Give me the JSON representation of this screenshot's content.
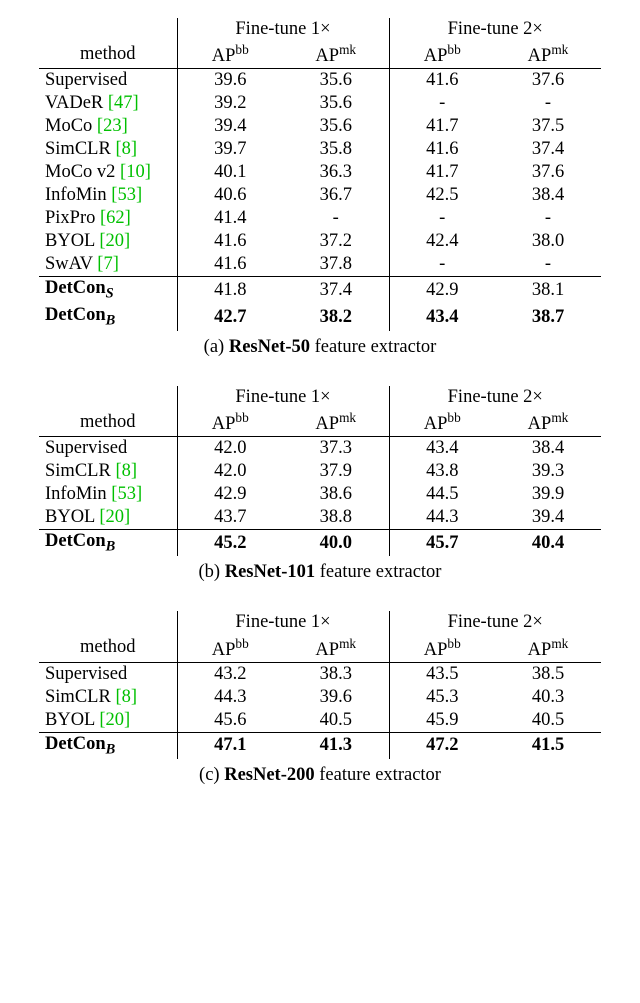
{
  "headers": {
    "method": "method",
    "ft1": "Fine-tune 1",
    "ft2": "Fine-tune 2",
    "times": "×",
    "ap": "AP",
    "bb": "bb",
    "mk": "mk"
  },
  "tables": [
    {
      "rows": [
        {
          "name": "Supervised",
          "cite": "",
          "bold": false,
          "ft1bb": "39.6",
          "ft1mk": "35.6",
          "ft2bb": "41.6",
          "ft2mk": "37.6"
        },
        {
          "name": "VADeR ",
          "cite": "[47]",
          "bold": false,
          "ft1bb": "39.2",
          "ft1mk": "35.6",
          "ft2bb": "-",
          "ft2mk": "-"
        },
        {
          "name": "MoCo ",
          "cite": "[23]",
          "bold": false,
          "ft1bb": "39.4",
          "ft1mk": "35.6",
          "ft2bb": "41.7",
          "ft2mk": "37.5"
        },
        {
          "name": "SimCLR ",
          "cite": "[8]",
          "bold": false,
          "ft1bb": "39.7",
          "ft1mk": "35.8",
          "ft2bb": "41.6",
          "ft2mk": "37.4"
        },
        {
          "name": "MoCo v2 ",
          "cite": "[10]",
          "bold": false,
          "ft1bb": "40.1",
          "ft1mk": "36.3",
          "ft2bb": "41.7",
          "ft2mk": "37.6"
        },
        {
          "name": "InfoMin ",
          "cite": "[53]",
          "bold": false,
          "ft1bb": "40.6",
          "ft1mk": "36.7",
          "ft2bb": "42.5",
          "ft2mk": "38.4"
        },
        {
          "name": "PixPro ",
          "cite": "[62]",
          "bold": false,
          "ft1bb": "41.4",
          "ft1mk": "-",
          "ft2bb": "-",
          "ft2mk": "-"
        },
        {
          "name": "BYOL ",
          "cite": "[20]",
          "bold": false,
          "ft1bb": "41.6",
          "ft1mk": "37.2",
          "ft2bb": "42.4",
          "ft2mk": "38.0"
        },
        {
          "name": "SwAV ",
          "cite": "[7]",
          "bold": false,
          "ft1bb": "41.6",
          "ft1mk": "37.8",
          "ft2bb": "-",
          "ft2mk": "-"
        },
        {
          "name": "DetCon",
          "sub": "S",
          "bold": true,
          "ft1bb": "41.8",
          "ft1mk": "37.4",
          "ft2bb": "42.9",
          "ft2mk": "38.1",
          "midrule": true,
          "valbold": false
        },
        {
          "name": "DetCon",
          "sub": "B",
          "bold": true,
          "ft1bb": "42.7",
          "ft1mk": "38.2",
          "ft2bb": "43.4",
          "ft2mk": "38.7",
          "valbold": true
        }
      ],
      "caption_a": "(a) ",
      "caption_b": "ResNet-50",
      "caption_c": " feature extractor"
    },
    {
      "rows": [
        {
          "name": "Supervised",
          "cite": "",
          "bold": false,
          "ft1bb": "42.0",
          "ft1mk": "37.3",
          "ft2bb": "43.4",
          "ft2mk": "38.4"
        },
        {
          "name": "SimCLR ",
          "cite": "[8]",
          "bold": false,
          "ft1bb": "42.0",
          "ft1mk": "37.9",
          "ft2bb": "43.8",
          "ft2mk": "39.3"
        },
        {
          "name": "InfoMin ",
          "cite": "[53]",
          "bold": false,
          "ft1bb": "42.9",
          "ft1mk": "38.6",
          "ft2bb": "44.5",
          "ft2mk": "39.9"
        },
        {
          "name": "BYOL ",
          "cite": "[20]",
          "bold": false,
          "ft1bb": "43.7",
          "ft1mk": "38.8",
          "ft2bb": "44.3",
          "ft2mk": "39.4"
        },
        {
          "name": "DetCon",
          "sub": "B",
          "bold": true,
          "ft1bb": "45.2",
          "ft1mk": "40.0",
          "ft2bb": "45.7",
          "ft2mk": "40.4",
          "midrule": true,
          "valbold": true
        }
      ],
      "caption_a": "(b) ",
      "caption_b": "ResNet-101",
      "caption_c": " feature extractor"
    },
    {
      "rows": [
        {
          "name": "Supervised",
          "cite": "",
          "bold": false,
          "ft1bb": "43.2",
          "ft1mk": "38.3",
          "ft2bb": "43.5",
          "ft2mk": "38.5"
        },
        {
          "name": "SimCLR ",
          "cite": "[8]",
          "bold": false,
          "ft1bb": "44.3",
          "ft1mk": "39.6",
          "ft2bb": "45.3",
          "ft2mk": "40.3"
        },
        {
          "name": "BYOL ",
          "cite": "[20]",
          "bold": false,
          "ft1bb": "45.6",
          "ft1mk": "40.5",
          "ft2bb": "45.9",
          "ft2mk": "40.5"
        },
        {
          "name": "DetCon",
          "sub": "B",
          "bold": true,
          "ft1bb": "47.1",
          "ft1mk": "41.3",
          "ft2bb": "47.2",
          "ft2mk": "41.5",
          "midrule": true,
          "valbold": true
        }
      ],
      "caption_a": "(c) ",
      "caption_b": "ResNet-200",
      "caption_c": " feature extractor"
    }
  ]
}
